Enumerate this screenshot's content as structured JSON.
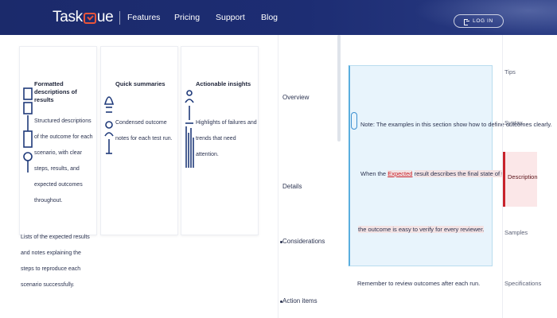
{
  "header": {
    "logo_text_left": "Task",
    "logo_text_right": "ue",
    "nav": [
      "Features",
      "Pricing",
      "Support",
      "Blog"
    ],
    "login_label": "LOG IN",
    "colors": {
      "background": "#1d2d73",
      "accent": "#e8543a"
    }
  },
  "cards": [
    {
      "icon": "stacked-boxes-icon",
      "title": "Formatted descriptions of results",
      "description": "Structured descriptions of the outcome for each scenario, with clear steps, results, and expected outcomes throughout.",
      "overflow": "Lists of the expected results and notes explaining the steps to reproduce each scenario successfully."
    },
    {
      "icon": "person-profile-icon",
      "title": "Quick summaries",
      "description": "Condensed outcome notes for each test run."
    },
    {
      "icon": "team-chart-icon",
      "title": "Actionable insights",
      "description": "Highlights of failures and trends that need attention."
    }
  ],
  "middle_nav": [
    "Overview",
    "Details",
    "Considerations",
    "Action items"
  ],
  "note": {
    "line1": "Note: The examples in this section show how to define outcomes clearly.",
    "line2_before": "When the",
    "line2_highlight": "Expected",
    "line2_after": "result describes the final state of the test,",
    "line3": "the outcome is easy to verify for every reviewer.",
    "bottom": "Remember to review outcomes after each run."
  },
  "right_rail": {
    "items": [
      "Tips",
      "Syntax",
      "Description",
      "Samples",
      "Specifications"
    ],
    "active": "Description",
    "active_color": "#c8232c"
  }
}
